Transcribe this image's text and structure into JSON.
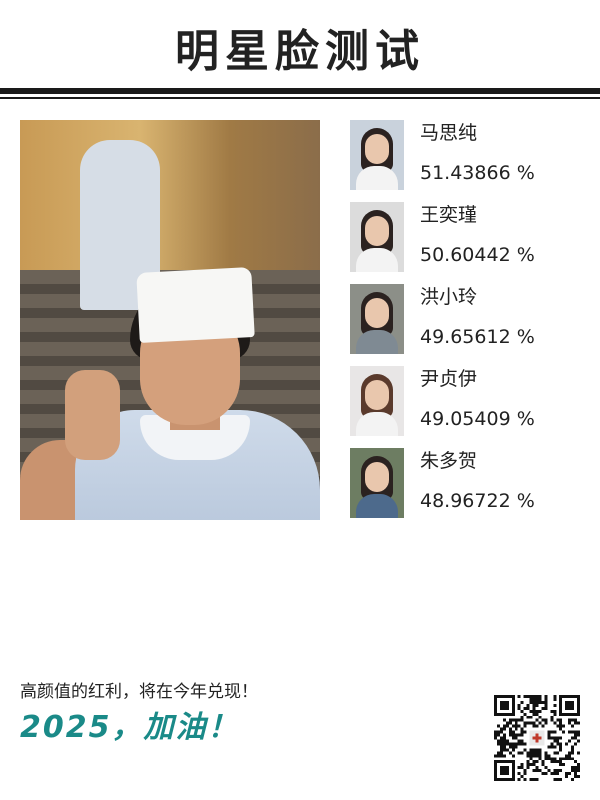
{
  "header": {
    "title": "明星脸测试"
  },
  "photo": {
    "alt": ""
  },
  "results": [
    {
      "name": "马思纯",
      "score": "51.43866 %"
    },
    {
      "name": "王奕瑾",
      "score": "50.60442 %"
    },
    {
      "name": "洪小玲",
      "score": "49.65612 %"
    },
    {
      "name": "尹贞伊",
      "score": "49.05409 %"
    },
    {
      "name": "朱多贺",
      "score": "48.96722 %"
    }
  ],
  "footer": {
    "line1": "高颜值的红利，将在今年兑现！",
    "line2": "2025，加油！"
  },
  "colors": {
    "accent": "#1a8a88",
    "text": "#222222"
  },
  "icons": {
    "qr": "qr-code-icon"
  }
}
